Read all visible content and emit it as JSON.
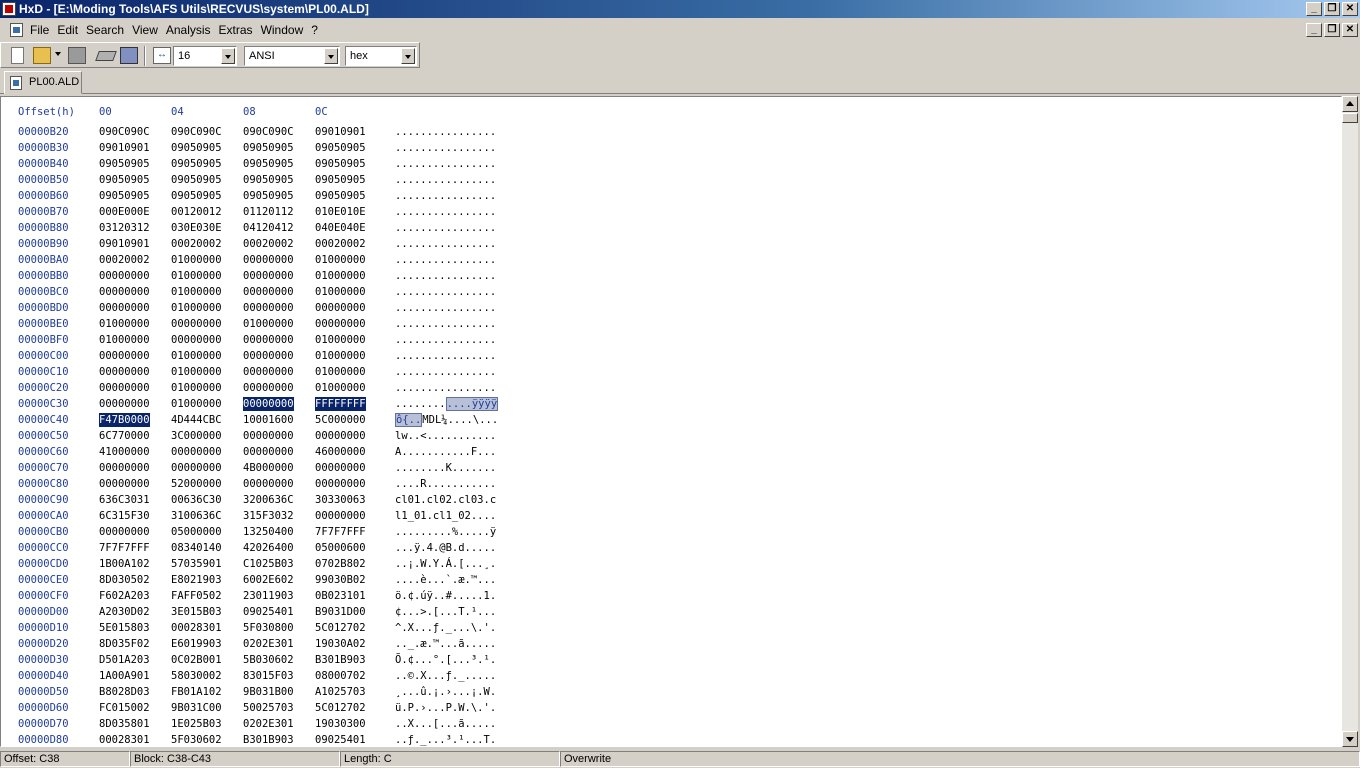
{
  "window": {
    "title": "HxD - [E:\\Moding Tools\\AFS Utils\\RECVUS\\system\\PL00.ALD]",
    "minimize": "_",
    "restore": "❐",
    "close": "✕"
  },
  "menu": {
    "items": [
      "File",
      "Edit",
      "Search",
      "View",
      "Analysis",
      "Extras",
      "Window",
      "?"
    ]
  },
  "toolbar": {
    "bytes_per_row": "16",
    "charset": "ANSI",
    "offset_base": "hex",
    "icons": [
      "new-file-icon",
      "open-file-icon",
      "save-icon",
      "open-ram-icon",
      "open-disk-icon",
      "bytes-per-row-icon"
    ]
  },
  "tab": {
    "label": "PL00.ALD"
  },
  "hex": {
    "header": {
      "offset": "Offset(h)",
      "cols": [
        "00",
        "04",
        "08",
        "0C"
      ]
    },
    "rows": [
      {
        "off": "00000B20",
        "h": [
          "090C090C",
          "090C090C",
          "090C090C",
          "09010901"
        ],
        "t": "................"
      },
      {
        "off": "00000B30",
        "h": [
          "09010901",
          "09050905",
          "09050905",
          "09050905"
        ],
        "t": "................"
      },
      {
        "off": "00000B40",
        "h": [
          "09050905",
          "09050905",
          "09050905",
          "09050905"
        ],
        "t": "................"
      },
      {
        "off": "00000B50",
        "h": [
          "09050905",
          "09050905",
          "09050905",
          "09050905"
        ],
        "t": "................"
      },
      {
        "off": "00000B60",
        "h": [
          "09050905",
          "09050905",
          "09050905",
          "09050905"
        ],
        "t": "................"
      },
      {
        "off": "00000B70",
        "h": [
          "000E000E",
          "00120012",
          "01120112",
          "010E010E"
        ],
        "t": "................"
      },
      {
        "off": "00000B80",
        "h": [
          "03120312",
          "030E030E",
          "04120412",
          "040E040E"
        ],
        "t": "................"
      },
      {
        "off": "00000B90",
        "h": [
          "09010901",
          "00020002",
          "00020002",
          "00020002"
        ],
        "t": "................"
      },
      {
        "off": "00000BA0",
        "h": [
          "00020002",
          "01000000",
          "00000000",
          "01000000"
        ],
        "t": "................"
      },
      {
        "off": "00000BB0",
        "h": [
          "00000000",
          "01000000",
          "00000000",
          "01000000"
        ],
        "t": "................"
      },
      {
        "off": "00000BC0",
        "h": [
          "00000000",
          "01000000",
          "00000000",
          "01000000"
        ],
        "t": "................"
      },
      {
        "off": "00000BD0",
        "h": [
          "00000000",
          "01000000",
          "00000000",
          "00000000"
        ],
        "t": "................"
      },
      {
        "off": "00000BE0",
        "h": [
          "01000000",
          "00000000",
          "01000000",
          "00000000"
        ],
        "t": "................"
      },
      {
        "off": "00000BF0",
        "h": [
          "01000000",
          "00000000",
          "00000000",
          "01000000"
        ],
        "t": "................"
      },
      {
        "off": "00000C00",
        "h": [
          "00000000",
          "01000000",
          "00000000",
          "01000000"
        ],
        "t": "................"
      },
      {
        "off": "00000C10",
        "h": [
          "00000000",
          "01000000",
          "00000000",
          "01000000"
        ],
        "t": "................"
      },
      {
        "off": "00000C20",
        "h": [
          "00000000",
          "01000000",
          "00000000",
          "01000000"
        ],
        "t": "................"
      },
      {
        "off": "00000C30",
        "h": [
          "00000000",
          "01000000",
          "00000000",
          "FFFFFFFF"
        ],
        "t": "........",
        "t_sel": "....ÿÿÿÿ"
      },
      {
        "off": "00000C40",
        "h": [
          "F47B0000",
          "4D444CBC",
          "10001600",
          "5C000000"
        ],
        "t_sel": "ô{..",
        "t": "MDL¼....\\..."
      },
      {
        "off": "00000C50",
        "h": [
          "6C770000",
          "3C000000",
          "00000000",
          "00000000"
        ],
        "t": "lw..<..........."
      },
      {
        "off": "00000C60",
        "h": [
          "41000000",
          "00000000",
          "00000000",
          "46000000"
        ],
        "t": "A...........F..."
      },
      {
        "off": "00000C70",
        "h": [
          "00000000",
          "00000000",
          "4B000000",
          "00000000"
        ],
        "t": "........K......."
      },
      {
        "off": "00000C80",
        "h": [
          "00000000",
          "52000000",
          "00000000",
          "00000000"
        ],
        "t": "....R..........."
      },
      {
        "off": "00000C90",
        "h": [
          "636C3031",
          "00636C30",
          "3200636C",
          "30330063"
        ],
        "t": "cl01.cl02.cl03.c"
      },
      {
        "off": "00000CA0",
        "h": [
          "6C315F30",
          "3100636C",
          "315F3032",
          "00000000"
        ],
        "t": "l1_01.cl1_02...."
      },
      {
        "off": "00000CB0",
        "h": [
          "00000000",
          "05000000",
          "13250400",
          "7F7F7FFF"
        ],
        "t": ".........%.....ÿ"
      },
      {
        "off": "00000CC0",
        "h": [
          "7F7F7FFF",
          "08340140",
          "42026400",
          "05000600"
        ],
        "t": "...ÿ.4.@B.d....."
      },
      {
        "off": "00000CD0",
        "h": [
          "1B00A102",
          "57035901",
          "C1025B03",
          "0702B802"
        ],
        "t": "..¡.W.Y.Á.[...¸."
      },
      {
        "off": "00000CE0",
        "h": [
          "8D030502",
          "E8021903",
          "6002E602",
          "99030B02"
        ],
        "t": "....è...`.æ.™..."
      },
      {
        "off": "00000CF0",
        "h": [
          "F602A203",
          "FAFF0502",
          "23011903",
          "0B023101"
        ],
        "t": "ö.¢.úÿ..#.....1."
      },
      {
        "off": "00000D00",
        "h": [
          "A2030D02",
          "3E015B03",
          "09025401",
          "B9031D00"
        ],
        "t": "¢...>.[...T.¹..."
      },
      {
        "off": "00000D10",
        "h": [
          "5E015803",
          "00028301",
          "5F030800",
          "5C012702"
        ],
        "t": "^.X...ƒ._...\\.'."
      },
      {
        "off": "00000D20",
        "h": [
          "8D035F02",
          "E6019903",
          "0202E301",
          "19030A02"
        ],
        "t": ".._.æ.™...ã....."
      },
      {
        "off": "00000D30",
        "h": [
          "D501A203",
          "0C02B001",
          "5B030602",
          "B301B903"
        ],
        "t": "Õ.¢...°.[...³.¹."
      },
      {
        "off": "00000D40",
        "h": [
          "1A00A901",
          "58030002",
          "83015F03",
          "08000702"
        ],
        "t": "..©.X...ƒ._....."
      },
      {
        "off": "00000D50",
        "h": [
          "B8028D03",
          "FB01A102",
          "9B031B00",
          "A1025703"
        ],
        "t": "¸...û.¡.›...¡.W."
      },
      {
        "off": "00000D60",
        "h": [
          "FC015002",
          "9B031C00",
          "50025703",
          "5C012702"
        ],
        "t": "ü.P.›...P.W.\\.'."
      },
      {
        "off": "00000D70",
        "h": [
          "8D035801",
          "1E025B03",
          "0202E301",
          "19030300"
        ],
        "t": "..X...[...ã....."
      },
      {
        "off": "00000D80",
        "h": [
          "00028301",
          "5F030602",
          "B301B903",
          "09025401"
        ],
        "t": "..ƒ._...³.¹...T."
      }
    ]
  },
  "status": {
    "offset": "Offset: C38",
    "block": "Block: C38-C43",
    "length": "Length: C",
    "empty": "",
    "mode": "Overwrite"
  }
}
